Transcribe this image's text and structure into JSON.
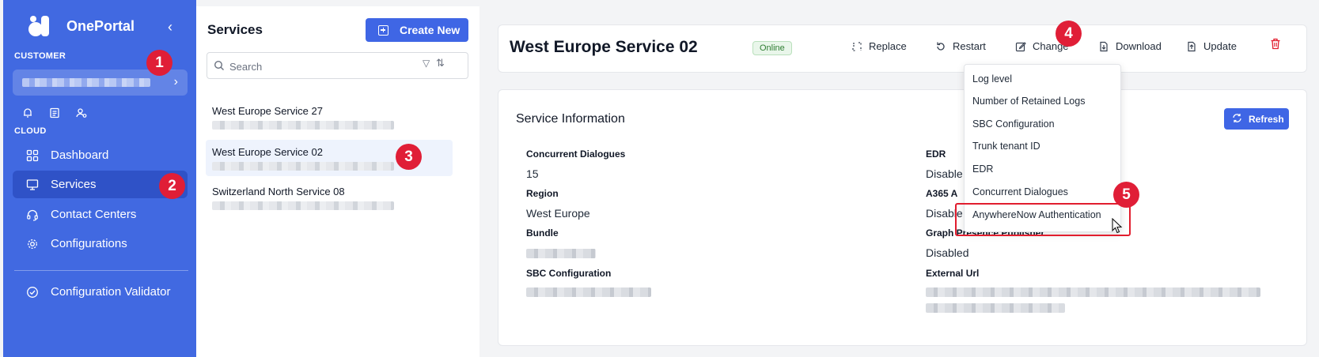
{
  "app": {
    "name": "OnePortal"
  },
  "sidebar": {
    "customer_label": "CUSTOMER",
    "cloud_label": "CLOUD",
    "nav": [
      {
        "label": "Dashboard",
        "icon": "grid-icon"
      },
      {
        "label": "Services",
        "icon": "monitor-icon",
        "active": true
      },
      {
        "label": "Contact Centers",
        "icon": "headset-icon"
      },
      {
        "label": "Configurations",
        "icon": "gear-icon"
      }
    ],
    "validator": {
      "label": "Configuration Validator",
      "icon": "check-circle-icon"
    }
  },
  "services_panel": {
    "title": "Services",
    "create_label": "Create New",
    "search_placeholder": "Search",
    "items": [
      {
        "name": "West Europe Service 27"
      },
      {
        "name": "West Europe Service 02",
        "selected": true
      },
      {
        "name": "Switzerland North Service 08"
      }
    ]
  },
  "header": {
    "title": "West Europe Service 02",
    "status": "Online",
    "actions": {
      "replace": "Replace",
      "restart": "Restart",
      "change": "Change",
      "download": "Download",
      "update": "Update"
    }
  },
  "info": {
    "title": "Service Information",
    "refresh_label": "Refresh",
    "fields": {
      "concurrent_label": "Concurrent Dialogues",
      "concurrent_value": "15",
      "region_label": "Region",
      "region_value": "West Europe",
      "bundle_label": "Bundle",
      "sbc_label": "SBC Configuration",
      "edr_label": "EDR",
      "edr_value": "Disable",
      "a365_label": "A365 A",
      "a365_value": "Disable",
      "graph_label": "Graph Presence Publisher",
      "graph_value": "Disabled",
      "external_label": "External Url"
    }
  },
  "change_menu": {
    "items": [
      "Log level",
      "Number of Retained Logs",
      "SBC Configuration",
      "Trunk tenant ID",
      "EDR",
      "Concurrent Dialogues",
      "AnywhereNow Authentication"
    ]
  },
  "steps": [
    "1",
    "2",
    "3",
    "4",
    "5"
  ],
  "colors": {
    "sidebar": "#4169e1",
    "sidebar_active": "#2f52c7",
    "primary_button": "#3f66e5",
    "step_marker": "#e01e37",
    "online": "#2e7d32"
  }
}
